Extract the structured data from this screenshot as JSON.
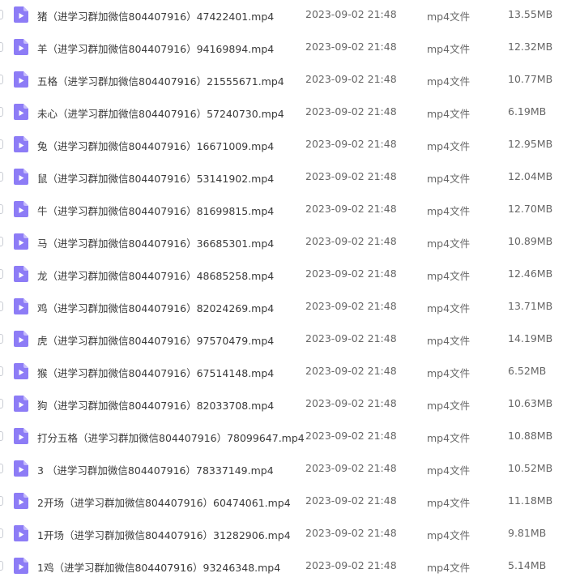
{
  "icon": {
    "name": "video-file-icon",
    "color": "#8d7cf6",
    "fold_color": "#c6bcfb"
  },
  "files": [
    {
      "name": "猪（进学习群加微信804407916）47422401.mp4",
      "date": "2023-09-02 21:48",
      "type": "mp4文件",
      "size": "13.55MB"
    },
    {
      "name": "羊（进学习群加微信804407916）94169894.mp4",
      "date": "2023-09-02 21:48",
      "type": "mp4文件",
      "size": "12.32MB"
    },
    {
      "name": "五格（进学习群加微信804407916）21555671.mp4",
      "date": "2023-09-02 21:48",
      "type": "mp4文件",
      "size": "10.77MB"
    },
    {
      "name": "未心（进学习群加微信804407916）57240730.mp4",
      "date": "2023-09-02 21:48",
      "type": "mp4文件",
      "size": "6.19MB"
    },
    {
      "name": "兔（进学习群加微信804407916）16671009.mp4",
      "date": "2023-09-02 21:48",
      "type": "mp4文件",
      "size": "12.95MB"
    },
    {
      "name": "鼠（进学习群加微信804407916）53141902.mp4",
      "date": "2023-09-02 21:48",
      "type": "mp4文件",
      "size": "12.04MB"
    },
    {
      "name": "牛（进学习群加微信804407916）81699815.mp4",
      "date": "2023-09-02 21:48",
      "type": "mp4文件",
      "size": "12.70MB"
    },
    {
      "name": "马（进学习群加微信804407916）36685301.mp4",
      "date": "2023-09-02 21:48",
      "type": "mp4文件",
      "size": "10.89MB"
    },
    {
      "name": "龙（进学习群加微信804407916）48685258.mp4",
      "date": "2023-09-02 21:48",
      "type": "mp4文件",
      "size": "12.46MB"
    },
    {
      "name": "鸡（进学习群加微信804407916）82024269.mp4",
      "date": "2023-09-02 21:48",
      "type": "mp4文件",
      "size": "13.71MB"
    },
    {
      "name": "虎（进学习群加微信804407916）97570479.mp4",
      "date": "2023-09-02 21:48",
      "type": "mp4文件",
      "size": "14.19MB"
    },
    {
      "name": "猴（进学习群加微信804407916）67514148.mp4",
      "date": "2023-09-02 21:48",
      "type": "mp4文件",
      "size": "6.52MB"
    },
    {
      "name": "狗（进学习群加微信804407916）82033708.mp4",
      "date": "2023-09-02 21:48",
      "type": "mp4文件",
      "size": "10.63MB"
    },
    {
      "name": "打分五格（进学习群加微信804407916）78099647.mp4",
      "date": "2023-09-02 21:48",
      "type": "mp4文件",
      "size": "10.88MB"
    },
    {
      "name": "3 （进学习群加微信804407916）78337149.mp4",
      "date": "2023-09-02 21:48",
      "type": "mp4文件",
      "size": "10.52MB"
    },
    {
      "name": "2开场（进学习群加微信804407916）60474061.mp4",
      "date": "2023-09-02 21:48",
      "type": "mp4文件",
      "size": "11.18MB"
    },
    {
      "name": "1开场（进学习群加微信804407916）31282906.mp4",
      "date": "2023-09-02 21:48",
      "type": "mp4文件",
      "size": "9.81MB"
    },
    {
      "name": "1鸡（进学习群加微信804407916）93246348.mp4",
      "date": "2023-09-02 21:48",
      "type": "mp4文件",
      "size": "5.14MB"
    }
  ]
}
